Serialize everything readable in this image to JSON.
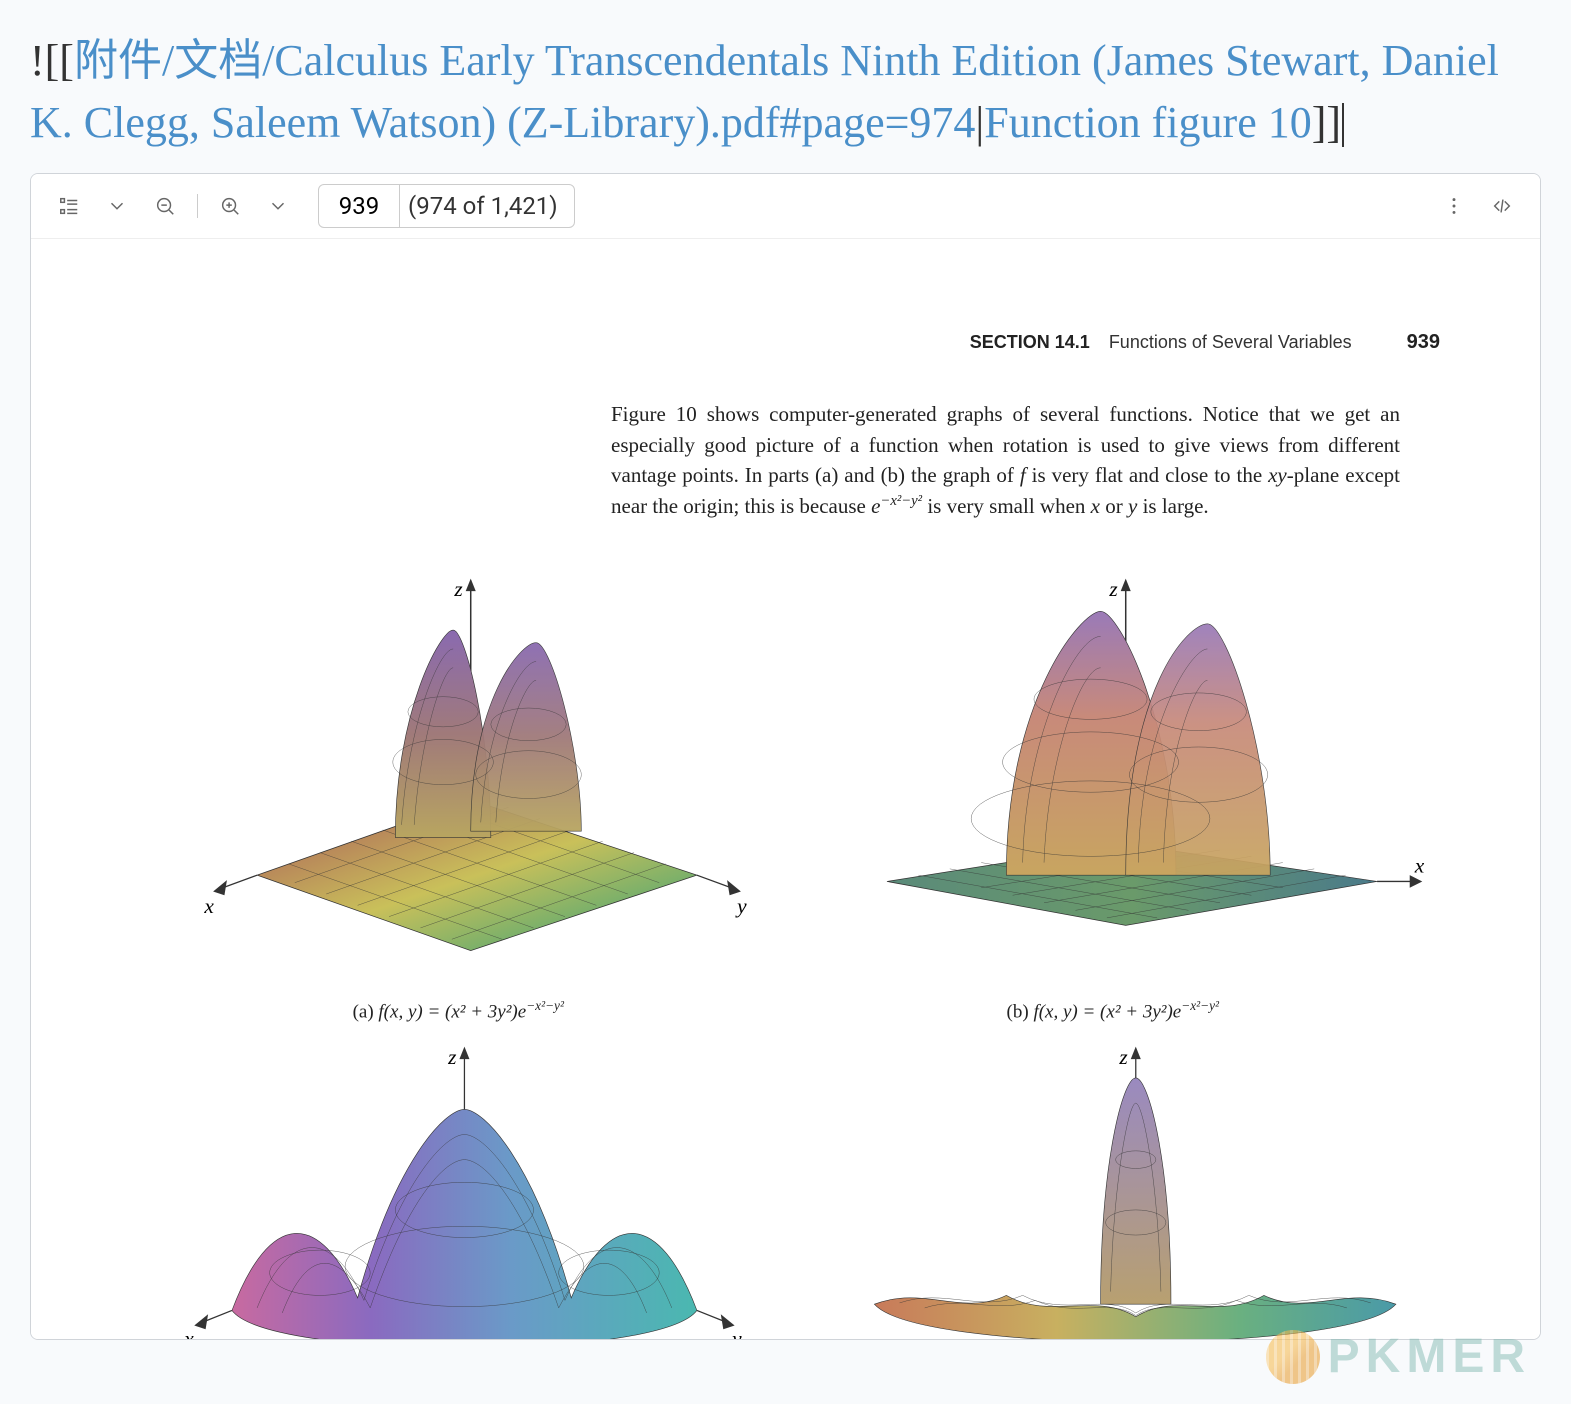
{
  "link": {
    "prefix": "![[",
    "path": "附件/文档/Calculus Early Transcendentals Ninth Edition (James Stewart, Daniel K. Clegg, Saleem Watson) (Z-Library).pdf#page=974",
    "separator": "|",
    "alias": "Function figure 10",
    "suffix": "]]"
  },
  "toolbar": {
    "page_input": "939",
    "page_total": "(974 of 1,421)"
  },
  "page": {
    "section_label": "SECTION 14.1",
    "section_title": "Functions of Several Variables",
    "page_number": "939",
    "paragraph_lead": "Figure 10 shows computer-generated graphs of several functions. Notice that we get an especially good picture of a function when rotation is used to give views from different vantage points. In parts (a) and (b) the graph of ",
    "paragraph_f": "f",
    "paragraph_mid": " is very flat and close to the ",
    "paragraph_xy": "xy",
    "paragraph_mid2": "-plane except near the origin; this is because ",
    "paragraph_exp_base": "e",
    "paragraph_exp_sup": "−x²−y²",
    "paragraph_tail": " is very small when ",
    "paragraph_x": "x",
    "paragraph_or": " or ",
    "paragraph_y": "y",
    "paragraph_end": " is large."
  },
  "figures": {
    "a": {
      "label": "(a) ",
      "fn": "f(x, y) = (x² + 3y²)e",
      "sup": "−x²−y²"
    },
    "b": {
      "label": "(b) ",
      "fn": "f(x, y) = (x² + 3y²)e",
      "sup": "−x²−y²"
    }
  },
  "axes": {
    "x": "x",
    "y": "y",
    "z": "z"
  },
  "watermark": "PKMER"
}
